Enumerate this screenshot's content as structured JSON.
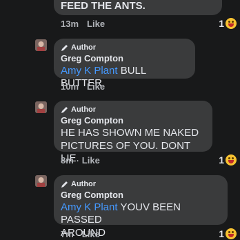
{
  "comments": [
    {
      "text": "FEED THE ANTS.",
      "time": "13m",
      "like_label": "Like",
      "reaction_count": "1"
    },
    {
      "author_badge": "Author",
      "author_name": "Greg Compton",
      "mention": "Amy K Plant",
      "text": "BULL BUTTER",
      "time": "10m",
      "like_label": "Like"
    },
    {
      "author_badge": "Author",
      "author_name": "Greg Compton",
      "text_line1": "HE HAS SHOWN ME NAKED",
      "text_line2": "PICTURES OF YOU. DONT LIE.",
      "time": "8m",
      "like_label": "Like",
      "reaction_count": "1"
    },
    {
      "author_badge": "Author",
      "author_name": "Greg Compton",
      "mention": "Amy K Plant",
      "text_line1": "YOUV BEEN PASSED",
      "text_line2": "AROUND",
      "time": "7m",
      "like_label": "Like",
      "reaction_count": "1"
    }
  ],
  "colors": {
    "background": "#18191a",
    "bubble": "#3a3b3c",
    "mention": "#4599ff",
    "meta": "#b0b3b8"
  },
  "icons": [
    "pencil-icon",
    "laughing-emoji-icon"
  ]
}
